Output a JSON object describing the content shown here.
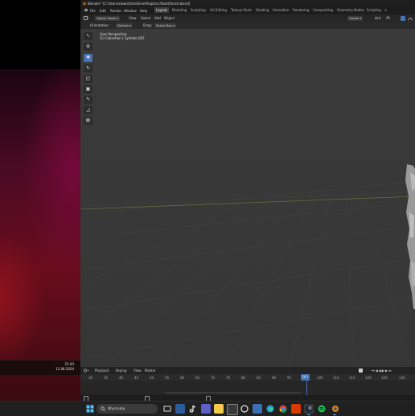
{
  "desktop": {
    "clock_time": "21:43",
    "clock_date": "12.08.2024"
  },
  "blender": {
    "title": "Blender* [C:\\Users\\slawm\\OneDrive\\Pulpit\\scif\\bolt\\finish.blend]",
    "menu": [
      "File",
      "Edit",
      "Render",
      "Window",
      "Help"
    ],
    "workspaces": [
      "Layout",
      "Modeling",
      "Sculpting",
      "UV Editing",
      "Texture Paint",
      "Shading",
      "Animation",
      "Rendering",
      "Compositing",
      "Geometry Nodes",
      "Scripting"
    ],
    "active_workspace": "Layout",
    "header": {
      "mode": "Object Mode",
      "view": "View",
      "select": "Select",
      "add": "Add",
      "object": "Object",
      "orientation_label": "Orientation:",
      "orientation_value": "Default",
      "drag_label": "Drag:",
      "drag_value": "Select Box",
      "transform_space": "Global"
    },
    "viewport": {
      "perspective": "User Perspective",
      "collection_info": "(1) Collection | Cylinder.007"
    },
    "timeline": {
      "menus": [
        "Playback",
        "Keying",
        "View",
        "Marker"
      ],
      "ticks": [
        "30",
        "35",
        "40",
        "45",
        "50",
        "55",
        "60",
        "65",
        "70",
        "75",
        "80",
        "85",
        "90",
        "95",
        "100",
        "105",
        "110",
        "115",
        "120",
        "125",
        "130"
      ],
      "current_frame": "100"
    }
  },
  "taskbar": {
    "search_placeholder": "Wyszukaj",
    "apps": [
      "task-view",
      "widgets",
      "tiktok",
      "teams",
      "file-explorer",
      "store",
      "chatgpt",
      "notes",
      "edge",
      "chrome",
      "office",
      "steam",
      "spotify",
      "blender"
    ]
  },
  "colors": {
    "accent": "#4772b3",
    "viewport_bg": "#393939",
    "wallpaper_red": "#6a0d1c",
    "taskbar": "#202020"
  }
}
